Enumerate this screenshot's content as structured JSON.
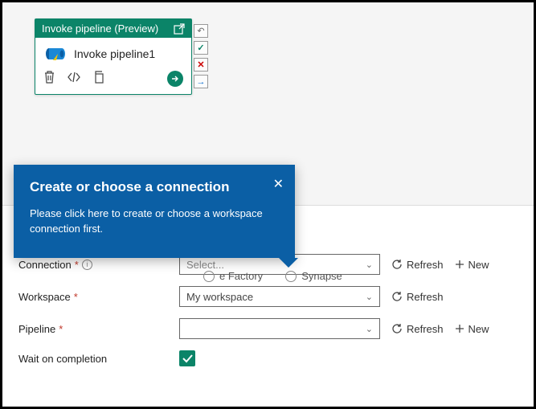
{
  "activity": {
    "header_title": "Invoke pipeline (Preview)",
    "name": "Invoke pipeline1"
  },
  "callout": {
    "title": "Create or choose a connection",
    "body": "Please click here to create or choose a workspace connection first."
  },
  "radio": {
    "factory": "e Factory",
    "synapse": "Synapse"
  },
  "form": {
    "connection": {
      "label": "Connection",
      "placeholder": "Select...",
      "refresh": "Refresh",
      "new": "New"
    },
    "workspace": {
      "label": "Workspace",
      "value": "My workspace",
      "refresh": "Refresh"
    },
    "pipeline": {
      "label": "Pipeline",
      "value": "",
      "refresh": "Refresh",
      "new": "New"
    },
    "wait": {
      "label": "Wait on completion",
      "checked": true
    }
  }
}
